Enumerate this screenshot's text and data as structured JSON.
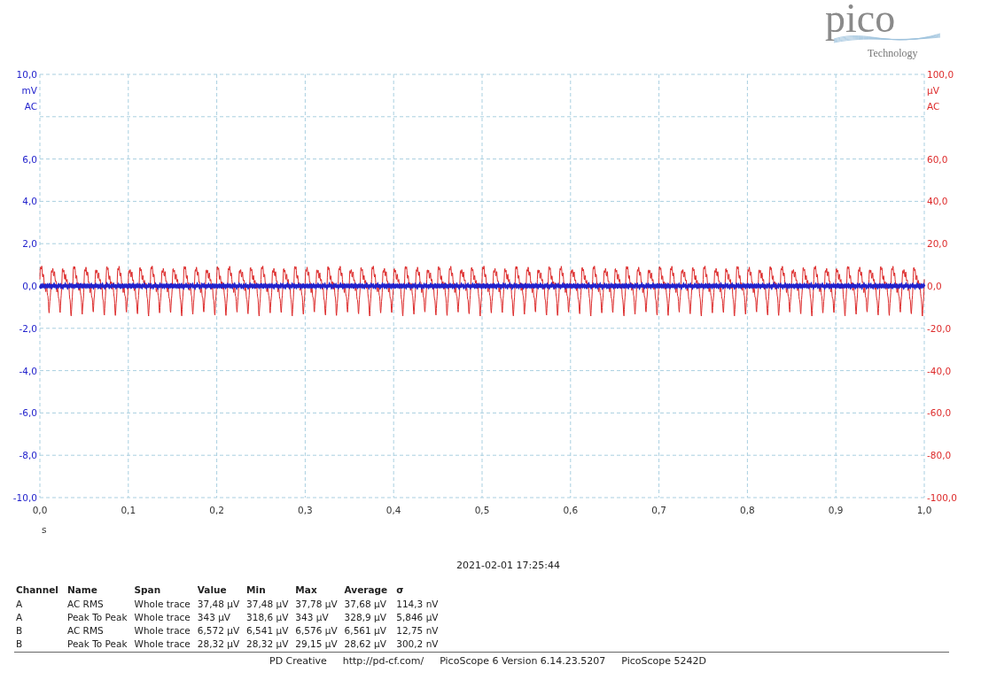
{
  "logo": {
    "word": "pico",
    "tagline": "Technology"
  },
  "scope": {
    "axes": [
      {
        "kind": "flat",
        "color": "#2222cc",
        "unit": "mV",
        "coupling": "AC",
        "ticks": [
          "10,0",
          "6,0",
          "4,0",
          "2,0",
          "0,0",
          "-2,0",
          "-4,0",
          "-6,0",
          "-8,0",
          "-10,0"
        ]
      },
      {
        "kind": "oscillating",
        "color": "#dd2a2a",
        "unit": "µV",
        "coupling": "AC",
        "ticks": [
          "100,0",
          "60,0",
          "40,0",
          "20,0",
          "0,0",
          "-20,0",
          "-40,0",
          "-60,0",
          "-80,0",
          "-100,0"
        ]
      }
    ],
    "x_axis": {
      "unit": "s",
      "ticks": [
        "0,0",
        "0,1",
        "0,2",
        "0,3",
        "0,4",
        "0,5",
        "0,6",
        "0,7",
        "0,8",
        "0,9",
        "1,0"
      ]
    }
  },
  "timestamp": "2021-02-01 17:25:44",
  "measurements": {
    "columns": [
      "Channel",
      "Name",
      "Span",
      "Value",
      "Min",
      "Max",
      "Average",
      "σ"
    ],
    "rows": [
      [
        "A",
        "AC RMS",
        "Whole trace",
        "37,48 µV",
        "37,48 µV",
        "37,78 µV",
        "37,68 µV",
        "114,3 nV"
      ],
      [
        "A",
        "Peak To Peak",
        "Whole trace",
        "343 µV",
        "318,6 µV",
        "343 µV",
        "328,9 µV",
        "5,846 µV"
      ],
      [
        "B",
        "AC RMS",
        "Whole trace",
        "6,572 µV",
        "6,541 µV",
        "6,576 µV",
        "6,561 µV",
        "12,75 nV"
      ],
      [
        "B",
        "Peak To Peak",
        "Whole trace",
        "28,32 µV",
        "28,32 µV",
        "29,15 µV",
        "28,62 µV",
        "300,2 nV"
      ]
    ]
  },
  "footer": [
    "PD Creative",
    "http://pd-cf.com/",
    "PicoScope 6 Version 6.14.23.5207",
    "PicoScope 5242D"
  ]
}
